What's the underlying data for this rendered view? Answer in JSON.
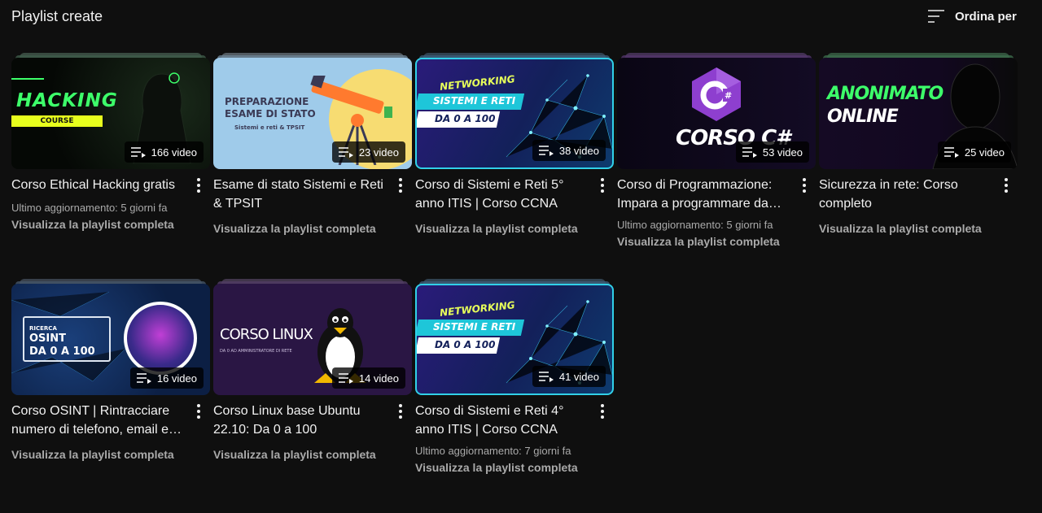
{
  "header": {
    "title": "Playlist create",
    "sort_label": "Ordina per"
  },
  "colors": {
    "background": "#0f0f0f",
    "text": "#f1f1f1",
    "secondary": "#aaaaaa"
  },
  "playlists": [
    {
      "title": "Corso Ethical Hacking gratis",
      "count": "166 video",
      "updated": "Ultimo aggiornamento: 5 giorni fa",
      "link": "Visualizza la playlist completa",
      "thumb": {
        "line1": "HACKING",
        "line2": "COURSE"
      }
    },
    {
      "title": "Esame di stato Sistemi e Reti & TPSIT",
      "count": "23 video",
      "link": "Visualizza la playlist completa",
      "thumb": {
        "line1": "PREPARAZIONE",
        "line2": "ESAME DI STATO",
        "line3": "Sistemi e reti & TPSIT"
      }
    },
    {
      "title": "Corso di Sistemi e Reti 5° anno ITIS | Corso CCNA",
      "count": "38 video",
      "link": "Visualizza la playlist completa",
      "thumb": {
        "line1": "NETWORKING",
        "line2": "SISTEMI E RETI",
        "line3": "DA 0 A 100"
      }
    },
    {
      "title": "Corso di Programmazione: Impara a programmare da…",
      "count": "53 video",
      "updated": "Ultimo aggiornamento: 5 giorni fa",
      "link": "Visualizza la playlist completa",
      "thumb": {
        "line1": "CORSO C#",
        "logo": "C#"
      }
    },
    {
      "title": "Sicurezza in rete: Corso completo",
      "count": "25 video",
      "link": "Visualizza la playlist completa",
      "thumb": {
        "line1": "ANONIMATO",
        "line2": "ONLINE"
      }
    },
    {
      "title": "Corso OSINT | Rintracciare numero di telefono, email e…",
      "count": "16 video",
      "link": "Visualizza la playlist completa",
      "thumb": {
        "line1": "RICERCA",
        "line2": "OSINT",
        "line3": "DA 0 A 100"
      }
    },
    {
      "title": "Corso Linux base Ubuntu 22.10: Da 0 a 100",
      "count": "14 video",
      "link": "Visualizza la playlist completa",
      "thumb": {
        "line1": "CORSO LINUX",
        "line2": "DA 0 AD AMMINISTRATORE DI RETE"
      }
    },
    {
      "title": "Corso di Sistemi e Reti 4° anno ITIS | Corso CCNA",
      "count": "41 video",
      "updated": "Ultimo aggiornamento: 7 giorni fa",
      "link": "Visualizza la playlist completa",
      "thumb": {
        "line1": "NETWORKING",
        "line2": "SISTEMI E RETI",
        "line3": "DA 0 A 100"
      }
    }
  ]
}
